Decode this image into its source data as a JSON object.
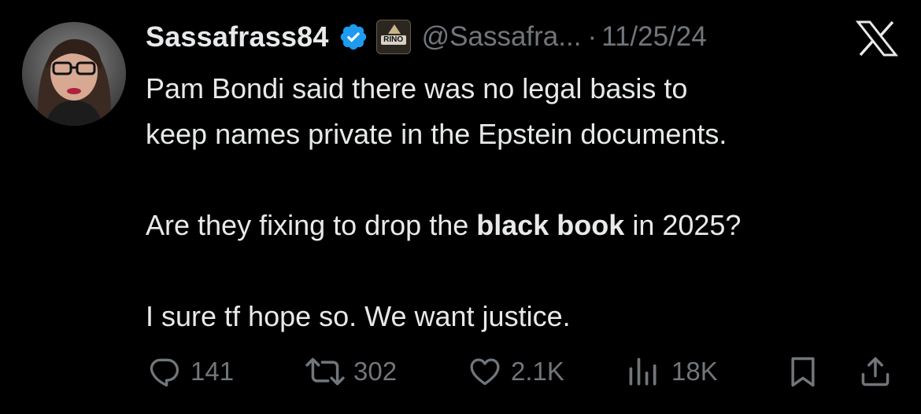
{
  "author": {
    "display_name": "Sassafrass84",
    "handle": "@Sassafra...",
    "badge_text": "RINO",
    "verified_color": "#1d9bf0"
  },
  "post": {
    "separator": "·",
    "date": "11/25/24",
    "line1": "Pam Bondi said there was no legal basis to",
    "line2": "keep names private in the Epstein documents.",
    "line3_before": "Are they fixing to drop the ",
    "line3_bold": "black book",
    "line3_after": " in 2025?",
    "line4": "I sure tf hope so. We want justice."
  },
  "actions": {
    "replies": "141",
    "reposts": "302",
    "likes": "2.1K",
    "views": "18K"
  },
  "colors": {
    "background": "#000000",
    "text": "#e7e9ea",
    "muted": "#71767b"
  },
  "icons": [
    "verified-badge-icon",
    "x-logo-icon",
    "reply-icon",
    "repost-icon",
    "like-icon",
    "views-icon",
    "bookmark-icon",
    "share-icon"
  ]
}
